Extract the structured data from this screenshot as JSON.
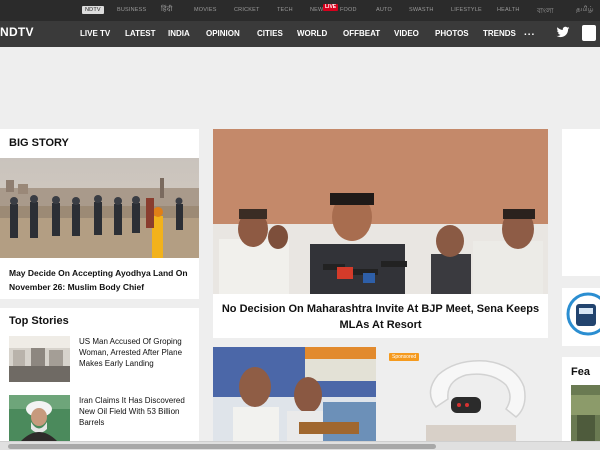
{
  "topbar": {
    "items": [
      {
        "label": "NDTV",
        "active": true
      },
      {
        "label": "BUSINESS"
      },
      {
        "label": "हिंदी"
      },
      {
        "label": "MOVIES"
      },
      {
        "label": "CRICKET"
      },
      {
        "label": "TECH"
      },
      {
        "label": "NEW"
      },
      {
        "label": "FOOD"
      },
      {
        "label": "AUTO"
      },
      {
        "label": "SWASTH"
      },
      {
        "label": "LIFESTYLE"
      },
      {
        "label": "HEALTH"
      },
      {
        "label": "বাংলা"
      },
      {
        "label": "தமிழ்"
      }
    ],
    "live_badge": "LIVE"
  },
  "navbar": {
    "logo": "NDTV",
    "items": [
      "LIVE TV",
      "LATEST",
      "INDIA",
      "OPINION",
      "CITIES",
      "WORLD",
      "OFFBEAT",
      "VIDEO",
      "PHOTOS",
      "TRENDS"
    ],
    "more": "...",
    "icons": [
      "twitter-icon",
      "facebook-icon"
    ]
  },
  "big_story": {
    "heading": "BIG STORY",
    "caption": "May Decide On Accepting Ayodhya Land On November 26: Muslim Body Chief"
  },
  "main_story": {
    "caption": "No Decision On Maharashtra Invite At BJP Meet, Sena Keeps MLAs At Resort"
  },
  "top_stories": {
    "heading": "Top Stories",
    "items": [
      {
        "text": "US Man Accused Of Groping Woman, Arrested After Plane Makes Early Landing"
      },
      {
        "text": "Iran Claims It Has Discovered New Oil Field With 53 Billion Barrels"
      }
    ]
  },
  "sponsored": {
    "badge": "Sponsored"
  },
  "right_column": {
    "feature_heading": "Fea"
  },
  "colors": {
    "topbar_bg": "#2b2b2b",
    "navbar_bg": "#3a3a3a",
    "live_red": "#d6001c",
    "sponsored_orange": "#f59a1e",
    "page_bg": "#eeeeee"
  }
}
